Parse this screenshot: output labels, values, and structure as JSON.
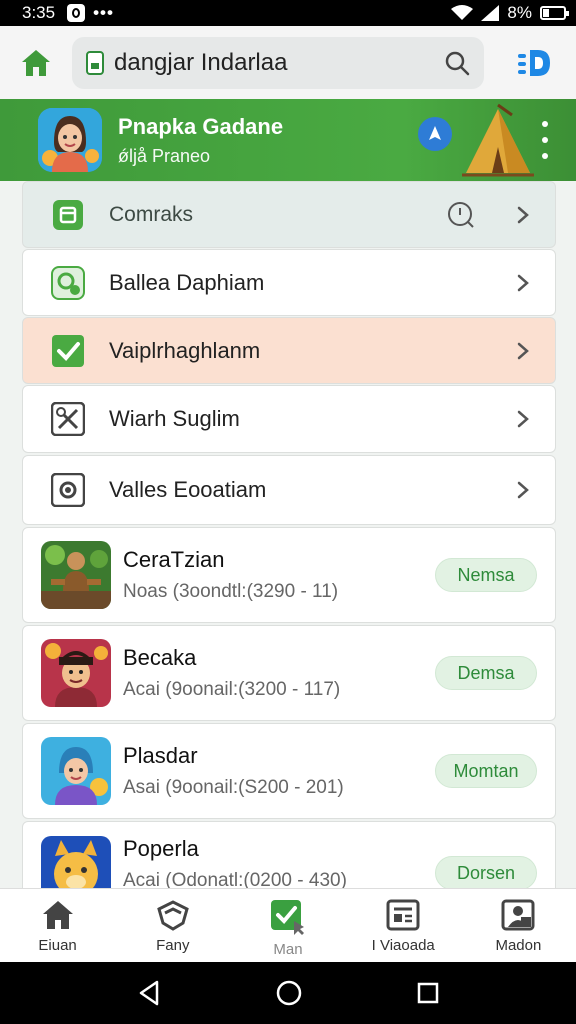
{
  "status_bar": {
    "time": "3:35",
    "battery": "8%"
  },
  "address_bar": {
    "url": "dangjar Indarlaa"
  },
  "banner": {
    "title": "Pnapka Gadane",
    "subtitle": "ǿljå Praneo"
  },
  "menu": {
    "header_label": "Comraks",
    "items": [
      {
        "label": "Ballea Daphiam"
      },
      {
        "label": "Vaiplrhaghlanm"
      },
      {
        "label": "Wiarh Suglim"
      },
      {
        "label": "Valles Eooatiam"
      }
    ]
  },
  "apps": [
    {
      "name": "CeraTzian",
      "meta": "Noas (3oondtl:(3290 - 11)",
      "button": "Nemsa"
    },
    {
      "name": "Becaka",
      "meta": "Acai (9oonail:(3200 - 117)",
      "button": "Demsa"
    },
    {
      "name": "Plasdar",
      "meta": "Asai (9oonail:(S200 - 201)",
      "button": "Momtan"
    },
    {
      "name": "Poperla",
      "meta": "Acai (Odonatl:(0200 - 430)",
      "button": "Dorsen"
    }
  ],
  "bottom_nav": [
    {
      "label": "Eiuan",
      "icon": "home-icon"
    },
    {
      "label": "Fany",
      "icon": "shield-icon"
    },
    {
      "label": "Man",
      "icon": "check-icon",
      "active": true
    },
    {
      "label": "I Viaoada",
      "icon": "news-icon"
    },
    {
      "label": "Madon",
      "icon": "image-icon"
    }
  ],
  "colors": {
    "accent": "#4aaa42",
    "highlight": "#fbe0d1",
    "button_bg": "#e2f2e3"
  }
}
